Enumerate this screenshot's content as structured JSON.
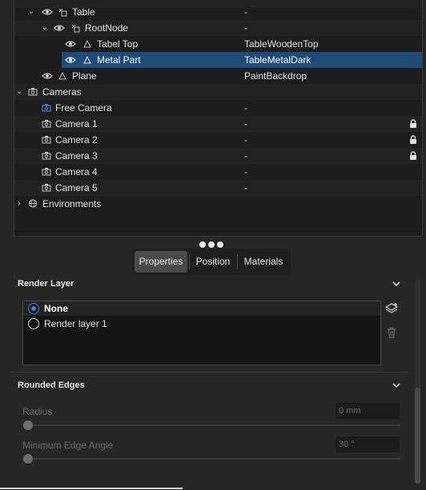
{
  "scene_tree": {
    "rows": [
      {
        "name": "",
        "value": ""
      },
      {
        "name": "Table",
        "value": "-"
      },
      {
        "name": "RootNode",
        "value": "-"
      },
      {
        "name": "Tabel Top",
        "value": "TableWoodenTop"
      },
      {
        "name": "Metal Part",
        "value": "TableMetalDark"
      },
      {
        "name": "Plane",
        "value": "PaintBackdrop"
      },
      {
        "name": "Cameras",
        "value": ""
      },
      {
        "name": "Free Camera",
        "value": "-"
      },
      {
        "name": "Camera 1",
        "value": "-"
      },
      {
        "name": "Camera 2",
        "value": "-"
      },
      {
        "name": "Camera 3",
        "value": "-"
      },
      {
        "name": "Camera 4",
        "value": "-"
      },
      {
        "name": "Camera 5",
        "value": "-"
      },
      {
        "name": "Environments",
        "value": ""
      }
    ]
  },
  "tabs": {
    "properties": "Properties",
    "position": "Position",
    "materials": "Materials"
  },
  "render_layer": {
    "title": "Render Layer",
    "options": [
      "None",
      "Render layer 1"
    ],
    "selected": "None"
  },
  "rounded_edges": {
    "title": "Rounded Edges",
    "radius_label": "Radius",
    "radius_value": "0 mm",
    "radius_fraction": 0.0,
    "angle_label": "Minimum Edge Angle",
    "angle_value": "30 °",
    "angle_fraction": 0.0
  },
  "icons": {
    "visibility": "eye-icon",
    "node": "node-icon",
    "camera": "camera-icon",
    "lock": "lock-icon",
    "globe": "globe-icon",
    "layers": "layers-add-icon",
    "delete": "trash-icon"
  },
  "colors": {
    "selection": "#1d4a78",
    "accent": "#3a86e0",
    "camera_icon_active": "#3a86e0"
  }
}
